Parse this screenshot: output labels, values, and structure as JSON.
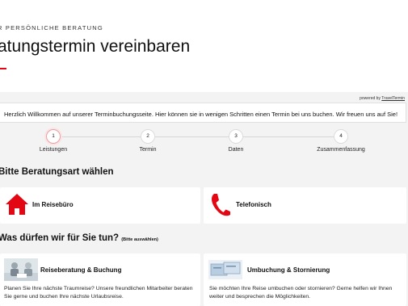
{
  "header": {
    "eyebrow": "R PERSÖNLICHE BERATUNG",
    "title": "atungstermin vereinbaren"
  },
  "powered_by": {
    "prefix": "powered by",
    "link": "TravelTermin"
  },
  "welcome_text": "Herzlich Willkommen auf unserer Terminbuchungsseite. Hier können sie in wenigen Schritten einen Termin bei uns buchen. Wir freuen uns auf Sie!",
  "steps": [
    {
      "number": "1",
      "label": "Leistungen",
      "active": true
    },
    {
      "number": "2",
      "label": "Termin",
      "active": false
    },
    {
      "number": "3",
      "label": "Daten",
      "active": false
    },
    {
      "number": "4",
      "label": "Zusammenfassung",
      "active": false
    }
  ],
  "consult_type": {
    "heading": "Bitte Beratungsart wählen",
    "options": [
      {
        "label": "Im Reisebüro",
        "icon": "house-icon"
      },
      {
        "label": "Telefonisch",
        "icon": "phone-icon"
      }
    ]
  },
  "services": {
    "heading": "Was dürfen wir für Sie tun?",
    "hint": "(Bitte auswählen)",
    "items": [
      {
        "title": "Reiseberatung & Buchung",
        "description": "Planen Sie Ihre nächste Traumreise? Unsere freundlichen Mitarbeiter beraten Sie gerne und buchen Ihre nächste Urlaubsreise.",
        "icon": "consultation-photo-icon"
      },
      {
        "title": "Umbuchung & Stornierung",
        "description": "Sie möchten Ihre Reise umbuchen oder stornieren? Gerne helfen wir Ihnen weiter und besprechen die Möglichkeiten.",
        "icon": "tickets-photo-icon"
      }
    ]
  },
  "colors": {
    "accent": "#e30613",
    "background": "#f3f3f3",
    "card": "#ffffff"
  }
}
